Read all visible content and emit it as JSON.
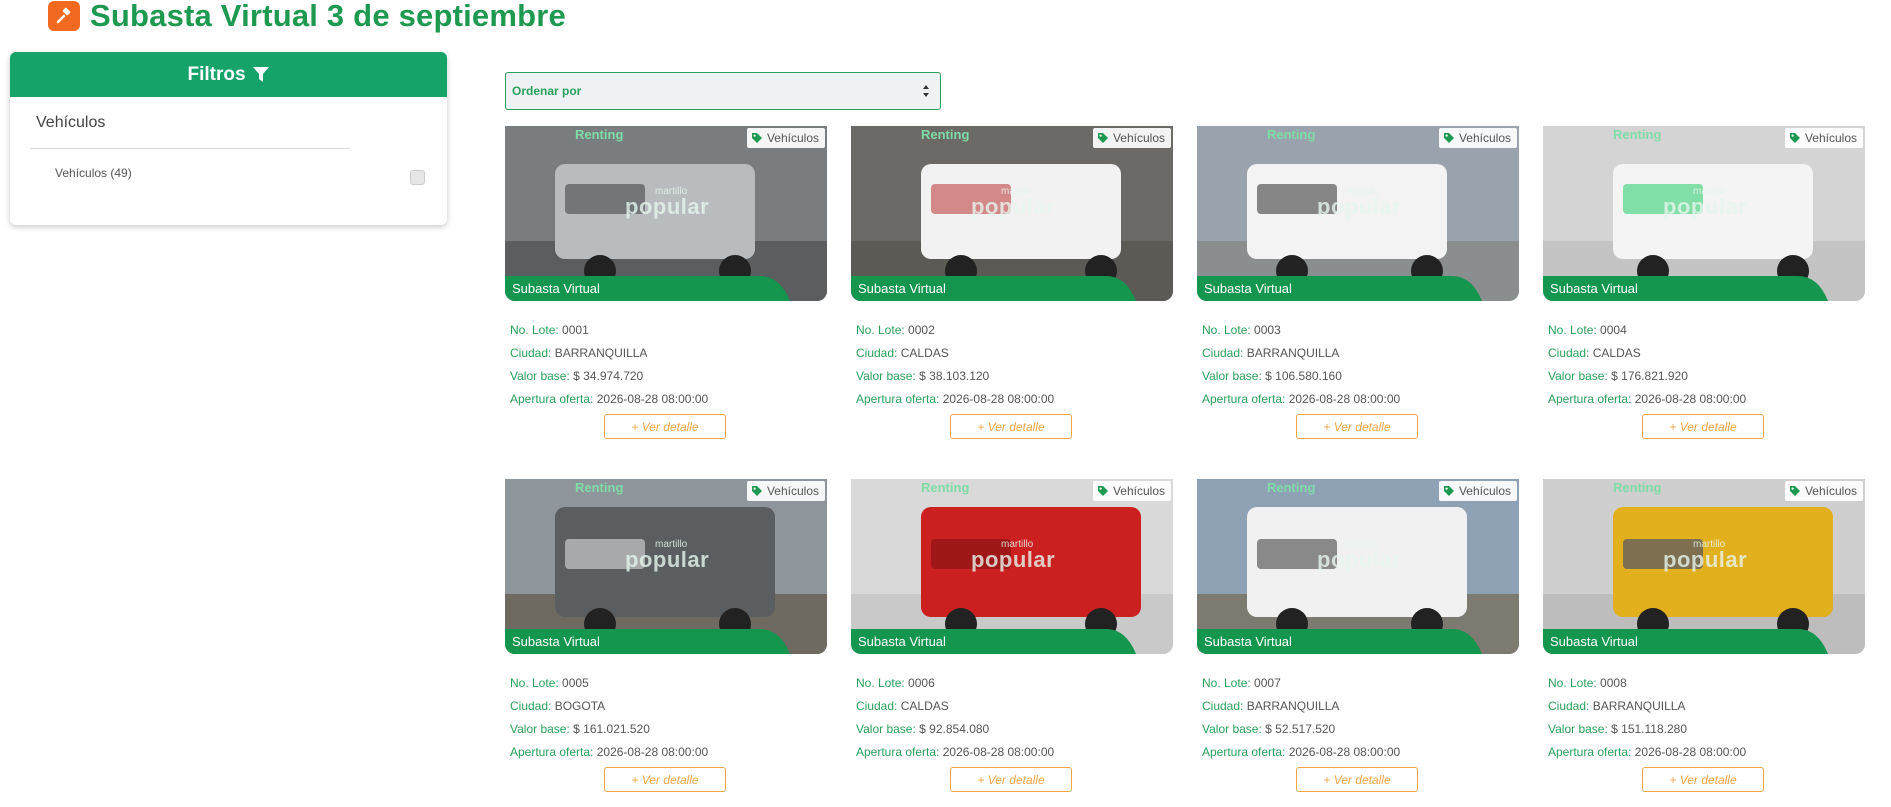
{
  "page": {
    "title": "Subasta Virtual 3 de septiembre",
    "icon": "gavel-icon",
    "colors": {
      "brand_green": "#1e9950",
      "header_green": "#16a36a",
      "accent_orange": "#f26a21",
      "button_orange": "#f0a548"
    }
  },
  "filters": {
    "header": "Filtros",
    "icon": "filter-icon",
    "group_title": "Vehículos",
    "option_label": "Vehículos (49)",
    "option_checked": false
  },
  "sort": {
    "label": "Ordenar por"
  },
  "lots": [
    {
      "category": "Vehículos",
      "banner": "Subasta Virtual",
      "lote": "0001",
      "ciudad": "BARRANQUILLA",
      "valor": "$ 34.974.720",
      "apertura": "2026-08-28 08:00:00",
      "button": "+ Ver detalle",
      "photo": "gray SUV"
    },
    {
      "category": "Vehículos",
      "banner": "Subasta Virtual",
      "lote": "0002",
      "ciudad": "CALDAS",
      "valor": "$ 38.103.120",
      "apertura": "2026-08-28 08:00:00",
      "button": "+ Ver detalle",
      "photo": "white van"
    },
    {
      "category": "Vehículos",
      "banner": "Subasta Virtual",
      "lote": "0003",
      "ciudad": "BARRANQUILLA",
      "valor": "$ 106.580.160",
      "apertura": "2026-08-28 08:00:00",
      "button": "+ Ver detalle",
      "photo": "white pickup"
    },
    {
      "category": "Vehículos",
      "banner": "Subasta Virtual",
      "lote": "0004",
      "ciudad": "CALDAS",
      "valor": "$ 176.821.920",
      "apertura": "2026-08-28 08:00:00",
      "button": "+ Ver detalle",
      "photo": "white truck"
    },
    {
      "category": "Vehículos",
      "banner": "Subasta Virtual",
      "lote": "0005",
      "ciudad": "BOGOTA",
      "valor": "$ 161.021.520",
      "apertura": "2026-08-28 08:00:00",
      "button": "+ Ver detalle",
      "photo": "cargo truck"
    },
    {
      "category": "Vehículos",
      "banner": "Subasta Virtual",
      "lote": "0006",
      "ciudad": "CALDAS",
      "valor": "$ 92.854.080",
      "apertura": "2026-08-28 08:00:00",
      "button": "+ Ver detalle",
      "photo": "red truck"
    },
    {
      "category": "Vehículos",
      "banner": "Subasta Virtual",
      "lote": "0007",
      "ciudad": "BARRANQUILLA",
      "valor": "$ 52.517.520",
      "apertura": "2026-08-28 08:00:00",
      "button": "+ Ver detalle",
      "photo": "white chassis truck"
    },
    {
      "category": "Vehículos",
      "banner": "Subasta Virtual",
      "lote": "0008",
      "ciudad": "BARRANQUILLA",
      "valor": "$ 151.118.280",
      "apertura": "2026-08-28 08:00:00",
      "button": "+ Ver detalle",
      "photo": "yellow truck"
    }
  ],
  "labels": {
    "lote": "No. Lote:",
    "ciudad": "Ciudad:",
    "valor": "Valor base:",
    "apertura": "Apertura oferta:"
  },
  "watermark": {
    "brand_small": "martillo",
    "brand_big": "popular",
    "renting": "Renting"
  }
}
